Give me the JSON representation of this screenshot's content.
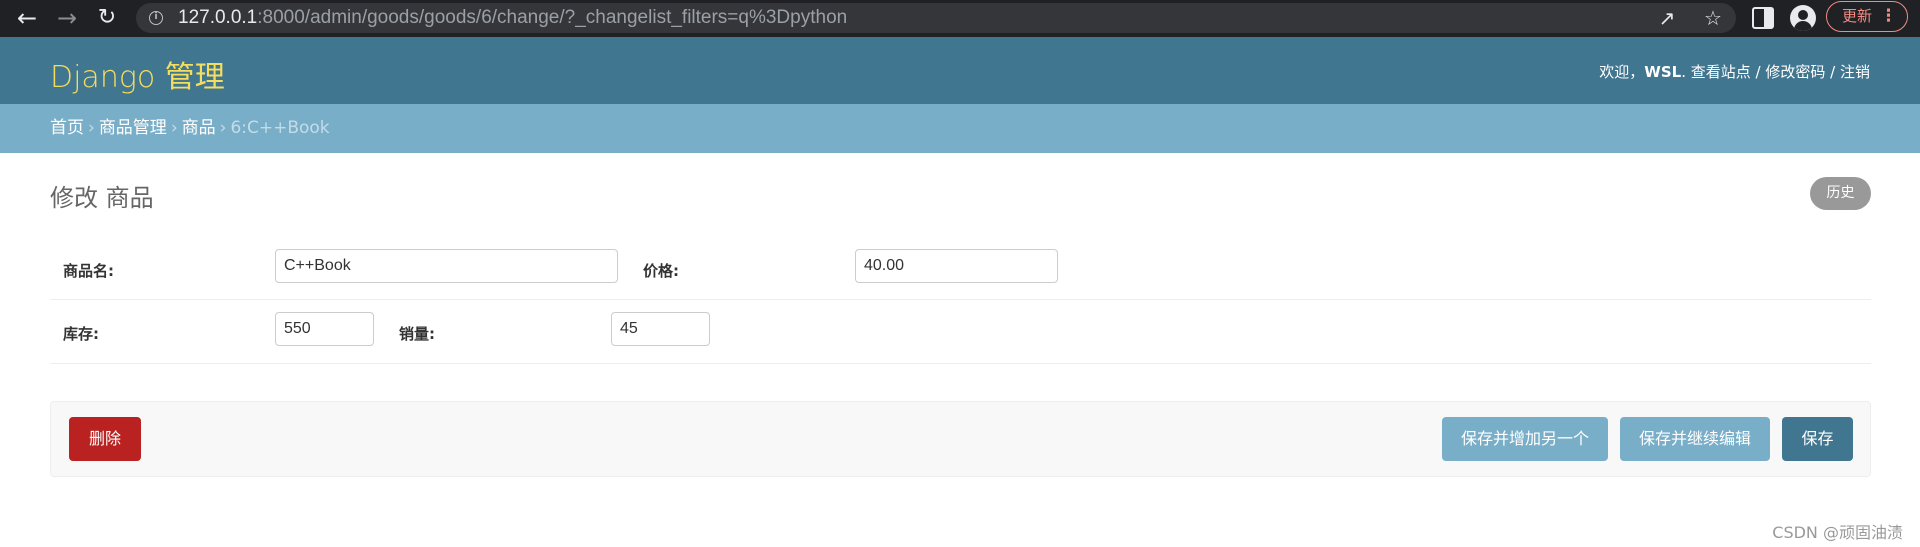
{
  "browser": {
    "url_host": "127.0.0.1",
    "url_rest": ":8000/admin/goods/goods/6/change/?_changelist_filters=q%3Dpython",
    "update_label": "更新"
  },
  "header": {
    "brand": "Django 管理",
    "welcome": "欢迎，",
    "username": "WSL",
    "view_site": "查看站点",
    "change_password": "修改密码",
    "logout": "注销"
  },
  "breadcrumbs": {
    "home": "首页",
    "app": "商品管理",
    "model": "商品",
    "current": "6:C++Book"
  },
  "page": {
    "title": "修改 商品",
    "history": "历史"
  },
  "form": {
    "name_label": "商品名:",
    "name_value": "C++Book",
    "price_label": "价格:",
    "price_value": "40.00",
    "stock_label": "库存:",
    "stock_value": "550",
    "sales_label": "销量:",
    "sales_value": "45"
  },
  "actions": {
    "delete": "删除",
    "save_add_another": "保存并增加另一个",
    "save_continue": "保存并继续编辑",
    "save": "保存"
  },
  "watermark": "CSDN @顽固油渍",
  "colors": {
    "header_bg": "#417690",
    "brand": "#f5dd5d",
    "breadcrumbs_bg": "#79aec8",
    "delete_bg": "#ba2121",
    "save_bg": "#417690",
    "secondary_btn_bg": "#79aec8"
  }
}
